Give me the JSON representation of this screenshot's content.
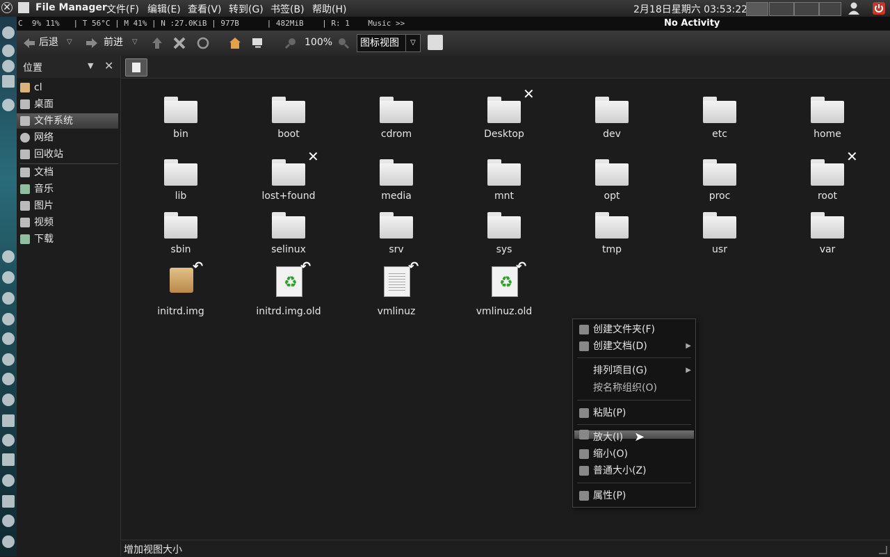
{
  "top_panel": {
    "app_title": "File Manager",
    "menus": [
      "文件(F)",
      "编辑(E)",
      "查看(V)",
      "转到(G)",
      "书签(B)",
      "帮助(H)"
    ],
    "clock": "2月18日星期六 03:53:22"
  },
  "stats_bar": {
    "text": "C  9% 11%   | T 56°C | M 41% | N :27.0KiB | 977B      | 482MiB    | R: 1    Music >>",
    "activity": "No Activity"
  },
  "toolbar": {
    "back_label": "后退",
    "forward_label": "前进",
    "zoom": "100%",
    "view_mode": "图标视图"
  },
  "sidebar": {
    "title": "位置",
    "places": [
      {
        "label": "cl",
        "icon": "home-icon"
      },
      {
        "label": "桌面",
        "icon": "desktop-icon"
      },
      {
        "label": "文件系统",
        "icon": "filesystem-icon",
        "selected": true
      },
      {
        "label": "网络",
        "icon": "network-icon"
      },
      {
        "label": "回收站",
        "icon": "trash-icon"
      }
    ],
    "bookmarks": [
      {
        "label": "文档",
        "icon": "documents-icon"
      },
      {
        "label": "音乐",
        "icon": "music-icon"
      },
      {
        "label": "图片",
        "icon": "pictures-icon"
      },
      {
        "label": "视频",
        "icon": "videos-icon"
      },
      {
        "label": "下载",
        "icon": "downloads-icon"
      }
    ]
  },
  "files": [
    {
      "name": "bin",
      "type": "folder"
    },
    {
      "name": "boot",
      "type": "folder"
    },
    {
      "name": "cdrom",
      "type": "folder"
    },
    {
      "name": "Desktop",
      "type": "folder",
      "badge": "unreadable"
    },
    {
      "name": "dev",
      "type": "folder"
    },
    {
      "name": "etc",
      "type": "folder"
    },
    {
      "name": "home",
      "type": "folder"
    },
    {
      "name": "lib",
      "type": "folder"
    },
    {
      "name": "lost+found",
      "type": "folder",
      "badge": "unreadable"
    },
    {
      "name": "media",
      "type": "folder"
    },
    {
      "name": "mnt",
      "type": "folder"
    },
    {
      "name": "opt",
      "type": "folder"
    },
    {
      "name": "proc",
      "type": "folder"
    },
    {
      "name": "root",
      "type": "folder",
      "badge": "unreadable"
    },
    {
      "name": "sbin",
      "type": "folder"
    },
    {
      "name": "selinux",
      "type": "folder"
    },
    {
      "name": "srv",
      "type": "folder"
    },
    {
      "name": "sys",
      "type": "folder"
    },
    {
      "name": "tmp",
      "type": "folder"
    },
    {
      "name": "usr",
      "type": "folder"
    },
    {
      "name": "var",
      "type": "folder"
    },
    {
      "name": "initrd.img",
      "type": "archive",
      "badge": "symlink"
    },
    {
      "name": "initrd.img.old",
      "type": "recycle",
      "badge": "symlink"
    },
    {
      "name": "vmlinuz",
      "type": "text",
      "badge": "symlink"
    },
    {
      "name": "vmlinuz.old",
      "type": "recycle",
      "badge": "symlink"
    }
  ],
  "context_menu": {
    "create_folder": "创建文件夹(F)",
    "create_document": "创建文档(D)",
    "arrange_items": "排列项目(G)",
    "organize_by_name": "按名称组织(O)",
    "paste": "粘贴(P)",
    "zoom_in": "放大(I)",
    "zoom_out": "缩小(O)",
    "normal_size": "普通大小(Z)",
    "properties": "属性(P)"
  },
  "status_bar": {
    "text": "增加视图大小"
  }
}
